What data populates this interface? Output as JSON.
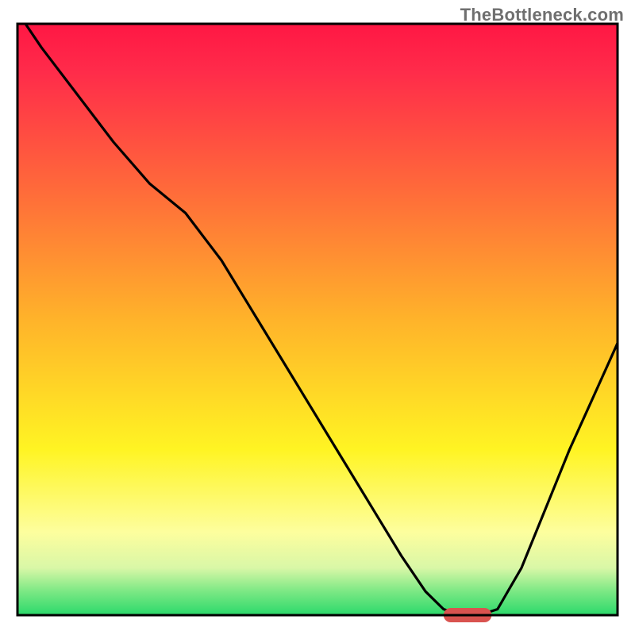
{
  "watermark": "TheBottleneck.com",
  "chart_data": {
    "type": "line",
    "title": "",
    "xlabel": "",
    "ylabel": "",
    "xlim": [
      0,
      100
    ],
    "ylim": [
      0,
      100
    ],
    "grid": false,
    "axes_visible": false,
    "background_gradient": {
      "stops": [
        {
          "offset": 0.0,
          "color": "#ff1744"
        },
        {
          "offset": 0.08,
          "color": "#ff2b4a"
        },
        {
          "offset": 0.28,
          "color": "#ff6a3a"
        },
        {
          "offset": 0.5,
          "color": "#ffb32a"
        },
        {
          "offset": 0.72,
          "color": "#fff423"
        },
        {
          "offset": 0.86,
          "color": "#fdfe9e"
        },
        {
          "offset": 0.92,
          "color": "#d9f7a7"
        },
        {
          "offset": 0.96,
          "color": "#7be884"
        },
        {
          "offset": 1.0,
          "color": "#2bd96b"
        }
      ]
    },
    "series": [
      {
        "name": "bottleneck-curve",
        "color": "#000000",
        "x": [
          0,
          4,
          10,
          16,
          22,
          28,
          34,
          40,
          46,
          52,
          58,
          64,
          68,
          71,
          74,
          77,
          80,
          84,
          88,
          92,
          96,
          100
        ],
        "y": [
          102,
          96,
          88,
          80,
          73,
          68,
          60,
          50,
          40,
          30,
          20,
          10,
          4,
          1,
          0,
          0,
          1,
          8,
          18,
          28,
          37,
          46
        ]
      }
    ],
    "marker": {
      "name": "optimal-range-marker",
      "color": "#d9534f",
      "x_start": 71,
      "x_end": 79,
      "y": 0,
      "thickness": 2.5
    }
  }
}
